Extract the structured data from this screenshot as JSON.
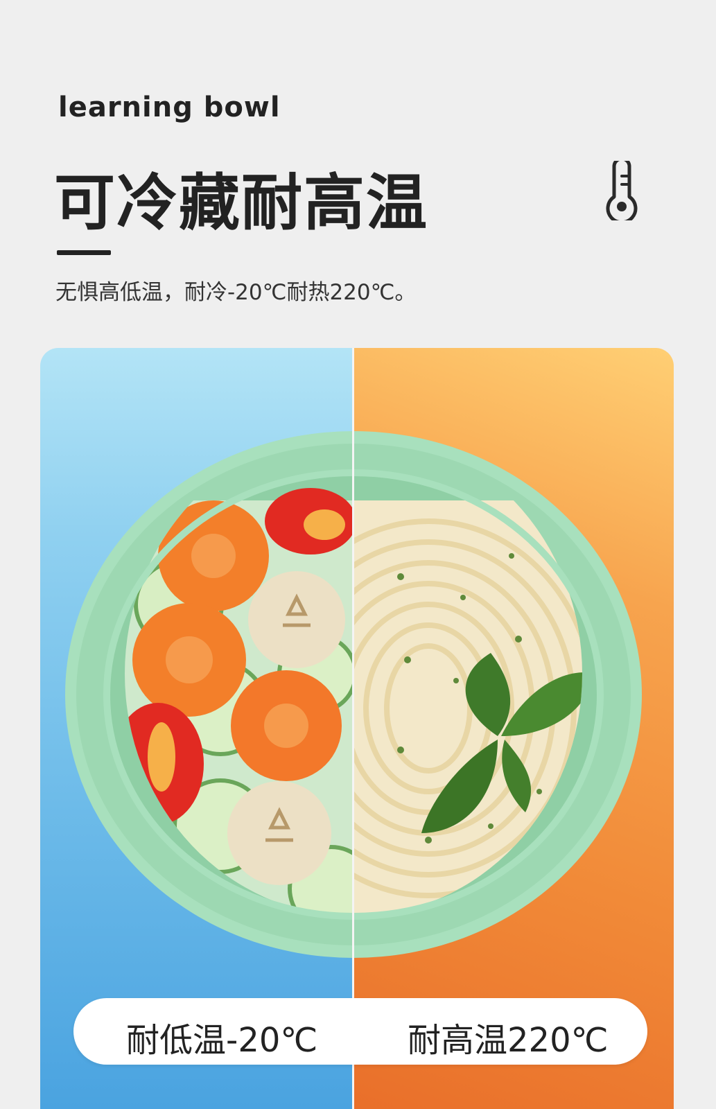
{
  "header": {
    "eyebrow": "learning bowl",
    "title": "可冷藏耐高温",
    "subtitle": "无惧高低温，耐冷-20℃耐热220℃。"
  },
  "icon": "thermometer-icon",
  "comparison": {
    "cold_label": "耐低温-20℃",
    "hot_label": "耐高温220℃"
  },
  "colors": {
    "cold_bg": "#6dbbe9",
    "hot_bg": "#f18a38",
    "bowl": "#a8e0bd"
  }
}
